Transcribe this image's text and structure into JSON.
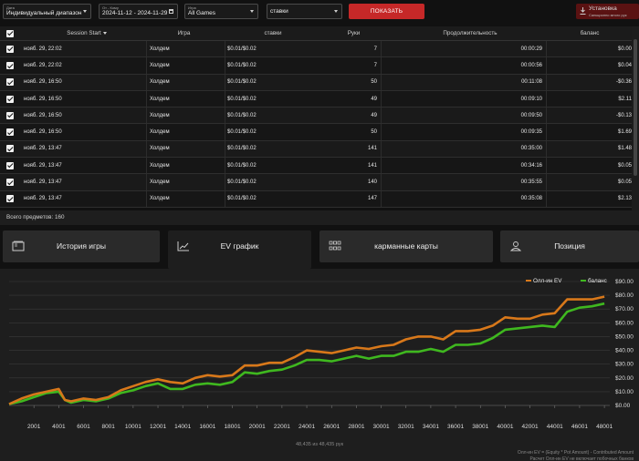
{
  "filters": {
    "date": {
      "label": "Дата",
      "value": "Индивидуальный диапазон"
    },
    "range": {
      "label": "От - Кому",
      "value": "2024-11-12 - 2024-11-29"
    },
    "game": {
      "label": "Игра",
      "value": "All Games"
    },
    "stakes": {
      "value": "ставки"
    },
    "show_button": "ПОКАЗАТЬ",
    "install": {
      "title": "Установка",
      "subtitle": "Санкционно много рук"
    }
  },
  "table": {
    "headers": {
      "session_start": "Session Start",
      "game": "Игра",
      "stakes": "ставки",
      "hands": "Руки",
      "duration": "Продолжительность",
      "balance": "баланс"
    },
    "rows": [
      {
        "date": "нояб. 29, 22:02",
        "game": "Холдем",
        "stakes": "$0.01/$0.02",
        "hands": "7",
        "duration": "00:00:29",
        "balance": "$0.00"
      },
      {
        "date": "нояб. 29, 22:02",
        "game": "Холдем",
        "stakes": "$0.01/$0.02",
        "hands": "7",
        "duration": "00:00:56",
        "balance": "$0.04"
      },
      {
        "date": "нояб. 29, 16:50",
        "game": "Холдем",
        "stakes": "$0.01/$0.02",
        "hands": "50",
        "duration": "00:11:08",
        "balance": "-$0.36"
      },
      {
        "date": "нояб. 29, 16:50",
        "game": "Холдем",
        "stakes": "$0.01/$0.02",
        "hands": "49",
        "duration": "00:09:10",
        "balance": "$2.11"
      },
      {
        "date": "нояб. 29, 16:50",
        "game": "Холдем",
        "stakes": "$0.01/$0.02",
        "hands": "49",
        "duration": "00:09:50",
        "balance": "-$0.13"
      },
      {
        "date": "нояб. 29, 16:50",
        "game": "Холдем",
        "stakes": "$0.01/$0.02",
        "hands": "50",
        "duration": "00:09:35",
        "balance": "$1.69"
      },
      {
        "date": "нояб. 29, 13:47",
        "game": "Холдем",
        "stakes": "$0.01/$0.02",
        "hands": "141",
        "duration": "00:35:00",
        "balance": "$1.48"
      },
      {
        "date": "нояб. 29, 13:47",
        "game": "Холдем",
        "stakes": "$0.01/$0.02",
        "hands": "141",
        "duration": "00:34:16",
        "balance": "$0.05"
      },
      {
        "date": "нояб. 29, 13:47",
        "game": "Холдем",
        "stakes": "$0.01/$0.02",
        "hands": "140",
        "duration": "00:35:55",
        "balance": "$0.05"
      },
      {
        "date": "нояб. 29, 13:47",
        "game": "Холдем",
        "stakes": "$0.01/$0.02",
        "hands": "147",
        "duration": "00:35:08",
        "balance": "$2.13"
      }
    ],
    "total": "Всего предметов: 160"
  },
  "tabs": [
    {
      "label": "История игры",
      "icon": "cards-history-icon",
      "active": false
    },
    {
      "label": "EV график",
      "icon": "line-chart-icon",
      "active": true
    },
    {
      "label": "карманные карты",
      "icon": "grid-icon",
      "active": false
    },
    {
      "label": "Позиция",
      "icon": "position-icon",
      "active": false
    }
  ],
  "colors": {
    "accent_red": "#c62828",
    "ev_series": "#d8781a",
    "balance_series": "#3fb81f"
  },
  "chart_data": {
    "type": "line",
    "xlim": [
      0,
      48435
    ],
    "ylim": [
      0,
      90
    ],
    "x_ticks": [
      "2001",
      "4001",
      "6001",
      "8001",
      "10001",
      "12001",
      "14001",
      "16001",
      "18001",
      "20001",
      "22001",
      "24001",
      "26001",
      "28001",
      "30001",
      "32001",
      "34001",
      "36001",
      "38001",
      "40001",
      "42001",
      "44001",
      "46001",
      "48001"
    ],
    "y_ticks": [
      "$90.00",
      "$80.00",
      "$70.00",
      "$60.00",
      "$50.00",
      "$40.00",
      "$30.00",
      "$20.00",
      "$10.00",
      "$0.00"
    ],
    "grid": "horizontal",
    "legend_position": "top-right",
    "series": [
      {
        "name": "Олл-ин EV",
        "color": "#d8781a",
        "x": [
          0,
          1000,
          2000,
          3000,
          4000,
          4500,
          5000,
          6000,
          7000,
          8000,
          9000,
          10000,
          11000,
          12000,
          13000,
          14000,
          15000,
          16000,
          17000,
          18000,
          19000,
          20000,
          21000,
          22000,
          23000,
          24000,
          25000,
          26000,
          27000,
          28000,
          29000,
          30000,
          31000,
          32000,
          33000,
          34000,
          35000,
          36000,
          37000,
          38000,
          39000,
          40000,
          41000,
          42000,
          43000,
          44000,
          45000,
          46000,
          47000,
          48000
        ],
        "y": [
          1,
          5,
          8,
          10,
          12,
          4,
          3,
          5,
          4,
          6,
          11,
          14,
          17,
          19,
          17,
          16,
          20,
          22,
          21,
          22,
          29,
          29,
          31,
          31,
          35,
          40,
          39,
          38,
          40,
          42,
          41,
          43,
          44,
          48,
          50,
          50,
          48,
          54,
          54,
          55,
          58,
          64,
          63,
          63,
          66,
          67,
          77,
          77,
          77,
          79
        ]
      },
      {
        "name": "баланс",
        "color": "#3fb81f",
        "x": [
          0,
          1000,
          2000,
          3000,
          4000,
          4500,
          5000,
          6000,
          7000,
          8000,
          9000,
          10000,
          11000,
          12000,
          13000,
          14000,
          15000,
          16000,
          17000,
          18000,
          19000,
          20000,
          21000,
          22000,
          23000,
          24000,
          25000,
          26000,
          27000,
          28000,
          29000,
          30000,
          31000,
          32000,
          33000,
          34000,
          35000,
          36000,
          37000,
          38000,
          39000,
          40000,
          41000,
          42000,
          43000,
          44000,
          45000,
          46000,
          47000,
          48000
        ],
        "y": [
          1,
          3,
          6,
          9,
          10,
          4,
          2,
          4,
          3,
          5,
          9,
          11,
          14,
          16,
          12,
          12,
          15,
          16,
          15,
          17,
          24,
          23,
          25,
          26,
          29,
          33,
          33,
          32,
          34,
          36,
          34,
          36,
          36,
          39,
          39,
          41,
          39,
          44,
          44,
          45,
          49,
          55,
          56,
          57,
          58,
          57,
          68,
          71,
          72,
          74
        ]
      }
    ],
    "footer": "48,435 из 48,435 рук",
    "notes": [
      "Олл-ин EV = (Equity * Pot Amount) - Contributed Amount",
      "Расчет Олл-ин EV не включает побочных банков"
    ]
  }
}
